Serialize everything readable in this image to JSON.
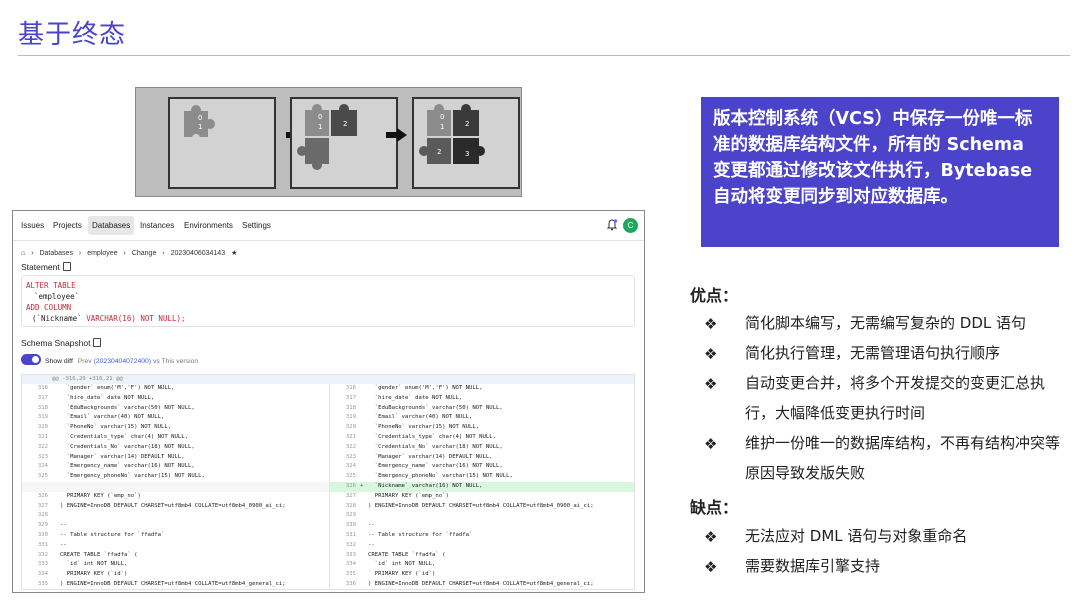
{
  "slide": {
    "title": "基于终态"
  },
  "puzzle": {
    "labels_panel1": [
      "0",
      "1"
    ],
    "labels_panel2": [
      "0",
      "1",
      "2"
    ],
    "labels_panel3": [
      "0",
      "1",
      "2",
      "2",
      "3"
    ]
  },
  "app": {
    "nav": [
      "Issues",
      "Projects",
      "Databases",
      "Instances",
      "Environments",
      "Settings"
    ],
    "active_nav": "Databases",
    "avatar_letter": "C",
    "breadcrumb": [
      "Databases",
      "employee",
      "Change",
      "20230406034143"
    ],
    "statement_label": "Statement",
    "statement": {
      "line1": "ALTER TABLE",
      "line2": "`employee`",
      "line3": "ADD COLUMN",
      "line4_name": "(`Nickname`",
      "line4_type": "VARCHAR(16)",
      "line4_tail": "NOT NULL);"
    },
    "schema_label": "Schema Snapshot",
    "show_diff": "Show diff",
    "prev_text": "Prev",
    "prev_link": "(20230404072400)",
    "vs_text": "vs This version",
    "hunk": "@@ -316,20 +316,21 @@",
    "left_rows": [
      {
        "ln": "316",
        "code": "  `gender` enum('M','F') NOT NULL,"
      },
      {
        "ln": "317",
        "code": "  `hire_date` date NOT NULL,"
      },
      {
        "ln": "318",
        "code": "  `EduBackgrounds` varchar(50) NOT NULL,"
      },
      {
        "ln": "319",
        "code": "  `Email` varchar(40) NOT NULL,"
      },
      {
        "ln": "320",
        "code": "  `PhoneNo` varchar(15) NOT NULL,"
      },
      {
        "ln": "321",
        "code": "  `Credentials_type` char(4) NOT NULL,"
      },
      {
        "ln": "322",
        "code": "  `Credentials_No` varchar(18) NOT NULL,"
      },
      {
        "ln": "323",
        "code": "  `Manager` varchar(14) DEFAULT NULL,"
      },
      {
        "ln": "324",
        "code": "  `Emergency_name` varchar(16) NOT NULL,"
      },
      {
        "ln": "325",
        "code": "  `Emergency_phoneNo` varchar(15) NOT NULL,"
      },
      {
        "ln": "",
        "code": "",
        "empty": true
      },
      {
        "ln": "326",
        "code": "  PRIMARY KEY (`emp_no`)"
      },
      {
        "ln": "327",
        "code": ") ENGINE=InnoDB DEFAULT CHARSET=utf8mb4 COLLATE=utf8mb4_0900_ai_ci;"
      },
      {
        "ln": "328",
        "code": ""
      },
      {
        "ln": "329",
        "code": "--"
      },
      {
        "ln": "330",
        "code": "-- Table structure for `ffadfa`"
      },
      {
        "ln": "331",
        "code": "--"
      },
      {
        "ln": "332",
        "code": "CREATE TABLE `ffadfa` ("
      },
      {
        "ln": "333",
        "code": "  `id` int NOT NULL,"
      },
      {
        "ln": "334",
        "code": "  PRIMARY KEY (`id`)"
      },
      {
        "ln": "335",
        "code": ") ENGINE=InnoDB DEFAULT CHARSET=utf8mb4 COLLATE=utf8mb4_general_ci;"
      }
    ],
    "right_rows": [
      {
        "ln": "316",
        "code": "  `gender` enum('M','F') NOT NULL,"
      },
      {
        "ln": "317",
        "code": "  `hire_date` date NOT NULL,"
      },
      {
        "ln": "318",
        "code": "  `EduBackgrounds` varchar(50) NOT NULL,"
      },
      {
        "ln": "319",
        "code": "  `Email` varchar(40) NOT NULL,"
      },
      {
        "ln": "320",
        "code": "  `PhoneNo` varchar(15) NOT NULL,"
      },
      {
        "ln": "321",
        "code": "  `Credentials_type` char(4) NOT NULL,"
      },
      {
        "ln": "322",
        "code": "  `Credentials_No` varchar(18) NOT NULL,"
      },
      {
        "ln": "323",
        "code": "  `Manager` varchar(14) DEFAULT NULL,"
      },
      {
        "ln": "324",
        "code": "  `Emergency_name` varchar(16) NOT NULL,"
      },
      {
        "ln": "325",
        "code": "  `Emergency_phoneNo` varchar(15) NOT NULL,"
      },
      {
        "ln": "326",
        "code": "  `Nickname` varchar(16) NOT NULL,",
        "added": true,
        "mark": "+"
      },
      {
        "ln": "327",
        "code": "  PRIMARY KEY (`emp_no`)"
      },
      {
        "ln": "328",
        "code": ") ENGINE=InnoDB DEFAULT CHARSET=utf8mb4 COLLATE=utf8mb4_0900_ai_ci;"
      },
      {
        "ln": "329",
        "code": ""
      },
      {
        "ln": "330",
        "code": "--"
      },
      {
        "ln": "331",
        "code": "-- Table structure for `ffadfa`"
      },
      {
        "ln": "332",
        "code": "--"
      },
      {
        "ln": "333",
        "code": "CREATE TABLE `ffadfa` ("
      },
      {
        "ln": "334",
        "code": "  `id` int NOT NULL,"
      },
      {
        "ln": "335",
        "code": "  PRIMARY KEY (`id`)"
      },
      {
        "ln": "336",
        "code": ") ENGINE=InnoDB DEFAULT CHARSET=utf8mb4 COLLATE=utf8mb4_general_ci;"
      }
    ]
  },
  "callout": {
    "text": "版本控制系统（VCS）中保存一份唯一标准的数据库结构文件，所有的 Schema 变更都通过修改该文件执行，Bytebase 自动将变更同步到对应数据库。"
  },
  "pros": {
    "heading": "优点：",
    "items": [
      "简化脚本编写，无需编写复杂的 DDL 语句",
      "简化执行管理，无需管理语句执行顺序",
      "自动变更合并，将多个开发提交的变更汇总执行，大幅降低变更执行时间",
      "维护一份唯一的数据库结构，不再有结构冲突等原因导致发版失败"
    ]
  },
  "cons": {
    "heading": "缺点：",
    "items": [
      "无法应对 DML 语句与对象重命名",
      "需要数据库引擎支持"
    ]
  },
  "bullet_glyph": "❖",
  "colors": {
    "accent": "#4b43c9",
    "added_line": "#d9f7df",
    "keyword": "#c02d3c"
  }
}
